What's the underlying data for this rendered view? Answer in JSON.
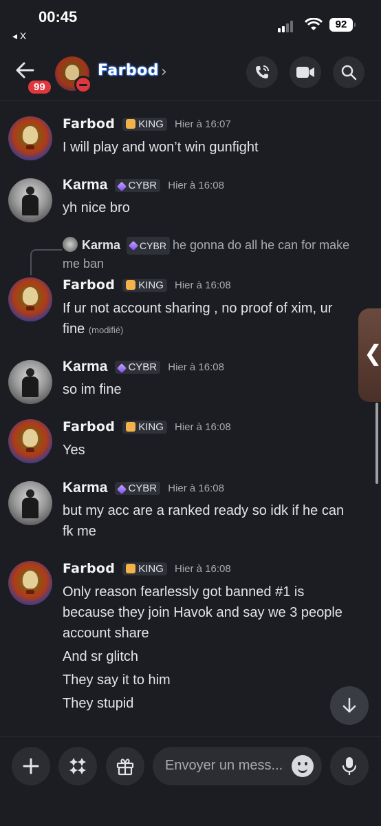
{
  "status_bar": {
    "time": "00:45",
    "back_app": "◂ X",
    "battery": "92"
  },
  "header": {
    "unread_badge": "99",
    "title": "Farbod",
    "chevron": "›",
    "icons": [
      "phone-call-icon",
      "video-camera-icon",
      "search-icon"
    ]
  },
  "messages": [
    {
      "author": "Farbod",
      "tag": "KING",
      "timestamp": "Hier à 16:07",
      "lines": [
        "I will play and won’t win gunfight"
      ]
    },
    {
      "author": "Karma",
      "tag": "CYBR",
      "timestamp": "Hier à 16:08",
      "lines": [
        "yh nice bro"
      ]
    },
    {
      "reply_to": {
        "author": "Karma",
        "tag": "CYBR",
        "text": "he gonna do all he can for make me ban"
      },
      "author": "Farbod",
      "tag": "KING",
      "timestamp": "Hier à 16:08",
      "lines": [
        "If ur not account sharing , no proof of xim, ur",
        "fine"
      ],
      "edited": "(modifié)"
    },
    {
      "author": "Karma",
      "tag": "CYBR",
      "timestamp": "Hier à 16:08",
      "lines": [
        "so im fine"
      ]
    },
    {
      "author": "Farbod",
      "tag": "KING",
      "timestamp": "Hier à 16:08",
      "lines": [
        "Yes"
      ]
    },
    {
      "author": "Karma",
      "tag": "CYBR",
      "timestamp": "Hier à 16:08",
      "lines": [
        "but my acc are a ranked ready so idk if he can",
        "fk me"
      ]
    },
    {
      "author": "Farbod",
      "tag": "KING",
      "timestamp": "Hier à 16:08",
      "lines": [
        "Only reason fearlessly got banned #1 is",
        "because they join Havok and say we 3 people",
        "account share",
        "And sr glitch",
        "They say it to him",
        "They stupid"
      ]
    }
  ],
  "side_handle": "❮",
  "composer": {
    "placeholder": "Envoyer un mess...",
    "buttons": [
      "plus-icon",
      "apps-icon",
      "gift-icon",
      "emoji-icon",
      "microphone-icon"
    ]
  },
  "colors": {
    "background": "#1c1d22",
    "badge": "#e0373e",
    "name_glow": "#3b82f6",
    "button": "#2b2d33"
  }
}
